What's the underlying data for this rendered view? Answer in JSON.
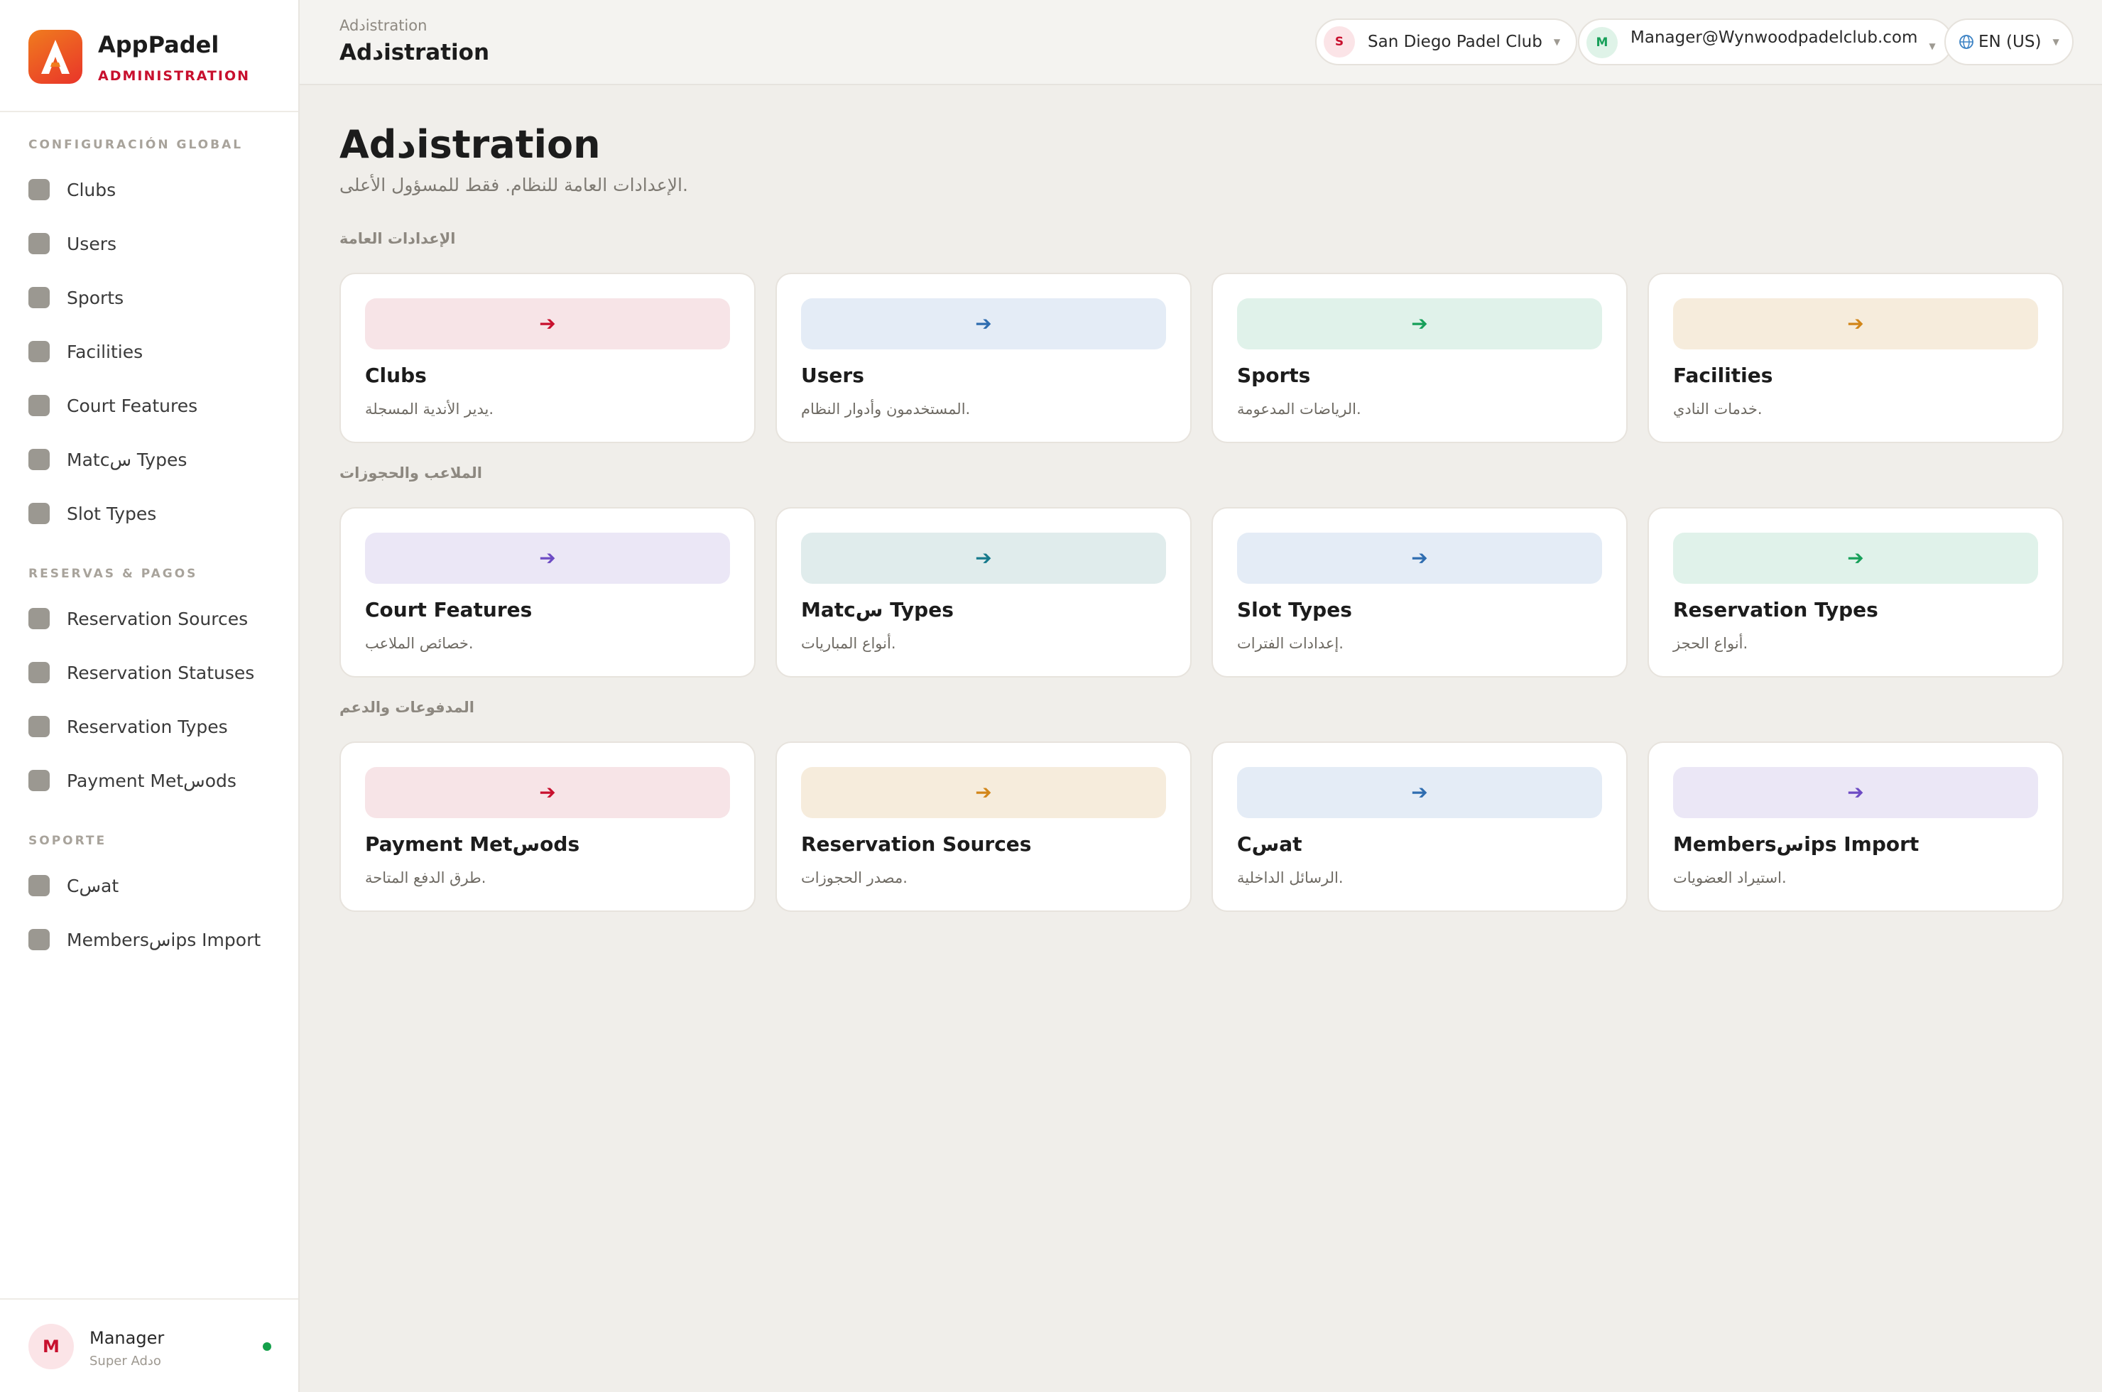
{
  "brand": {
    "name": "AppPadel",
    "subtitle": "ADMINISTRATION"
  },
  "sidebar": {
    "sections": [
      {
        "title": "CONFIGURACIÓN GLOBAL",
        "items": [
          "Clubs",
          "Users",
          "Sports",
          "Facilities",
          "Court Features",
          "Matcس Types",
          "Slot Types"
        ]
      },
      {
        "title": "RESERVAS & PAGOS",
        "items": [
          "Reservation Sources",
          "Reservation Statuses",
          "Reservation Types",
          "Payment Metسods"
        ]
      },
      {
        "title": "SOPORTE",
        "items": [
          "Cسat",
          "Membersسips Import"
        ]
      }
    ],
    "profile": {
      "initial": "M",
      "name": "Manager",
      "role": "Super Adدo"
    }
  },
  "header": {
    "breadcrumb": "Adدistration",
    "title": "Adدistration",
    "club": {
      "initial": "S",
      "name": "San Diego Padel Club"
    },
    "user": {
      "initial": "M",
      "email": "Manager@Wynwoodpadelclub.com"
    },
    "language": "EN (US)"
  },
  "main": {
    "title": "Adدistration",
    "description": "الإعدادات العامة للنظام. فقط للمسؤول الأعلى.",
    "groups": [
      {
        "title": "الإعدادات العامة",
        "cards": [
          {
            "title": "Clubs",
            "description": "يدير الأندية المسجلة.",
            "color": "#c8102e",
            "bg": "#f7e4e7"
          },
          {
            "title": "Users",
            "description": "المستخدمون وأدوار النظام.",
            "color": "#2f6db0",
            "bg": "#e4ecf6"
          },
          {
            "title": "Sports",
            "description": "الرياضات المدعومة.",
            "color": "#18a05a",
            "bg": "#e0f2ea"
          },
          {
            "title": "Facilities",
            "description": "خدمات النادي.",
            "color": "#d2861a",
            "bg": "#f6ecdc"
          }
        ]
      },
      {
        "title": "الملاعب والحجوزات",
        "cards": [
          {
            "title": "Court Features",
            "description": "خصائص الملاعب.",
            "color": "#6d4bc4",
            "bg": "#ebe7f6"
          },
          {
            "title": "Matcس Types",
            "description": "أنواع المباريات.",
            "color": "#167a8c",
            "bg": "#e0ecec"
          },
          {
            "title": "Slot Types",
            "description": "إعدادات الفترات.",
            "color": "#2f6db0",
            "bg": "#e4ecf6"
          },
          {
            "title": "Reservation Types",
            "description": "أنواع الحجز.",
            "color": "#18a05a",
            "bg": "#e0f2ea"
          }
        ]
      },
      {
        "title": "المدفوعات والدعم",
        "cards": [
          {
            "title": "Payment Metسods",
            "description": "طرق الدفع المتاحة.",
            "color": "#c8102e",
            "bg": "#f7e4e7"
          },
          {
            "title": "Reservation Sources",
            "description": "مصدر الحجوزات.",
            "color": "#d2861a",
            "bg": "#f6ecdc"
          },
          {
            "title": "Cسat",
            "description": "الرسائل الداخلية.",
            "color": "#2f6db0",
            "bg": "#e4ecf6"
          },
          {
            "title": "Membersسips Import",
            "description": "استيراد العضويات.",
            "color": "#6d4bc4",
            "bg": "#ebe7f6"
          }
        ]
      }
    ]
  }
}
